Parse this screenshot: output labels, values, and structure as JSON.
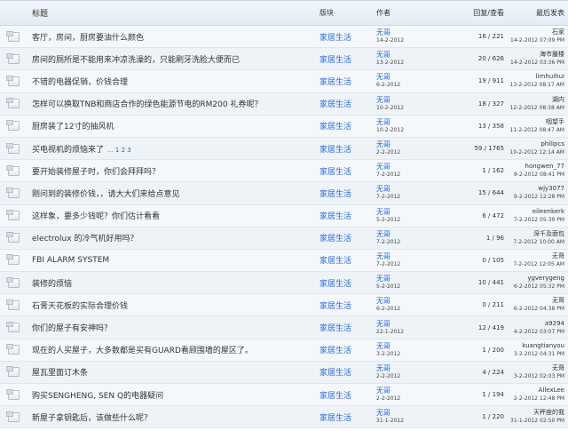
{
  "header": {
    "title": "标题",
    "board": "版块",
    "author": "作者",
    "stats": "回复/查看",
    "last_post": "最后发表"
  },
  "topics": [
    {
      "title": "客厅，房间，厨房要油什么颜色",
      "pages": "",
      "board": "家居生活",
      "author": "无哥",
      "date": "14-2-2012",
      "stats": "16 / 221",
      "last_user": "石家",
      "last_time": "14-2-2012 07:09 PM"
    },
    {
      "title": "房间的厕所是不能用来冲凉洗澡的，只能刷牙洗脸大便而已",
      "pages": "",
      "board": "家居生活",
      "author": "无哥",
      "date": "13-2-2012",
      "stats": "20 / 626",
      "last_user": "海市蜃楼",
      "last_time": "14-2-2012 03:36 PM"
    },
    {
      "title": "不错的电器促销，价钱合理",
      "pages": "",
      "board": "家居生活",
      "author": "无哥",
      "date": "6-2-2012",
      "stats": "19 / 911",
      "last_user": "limhuihui",
      "last_time": "13-2-2012 08:17 AM"
    },
    {
      "title": "怎样可以换取TNB和商店合作的绿色能源节电的RM200 礼券呢？",
      "pages": "",
      "board": "家居生活",
      "author": "无哥",
      "date": "10-2-2012",
      "stats": "18 / 327",
      "last_user": "湖内",
      "last_time": "12-2-2012 08:38 AM"
    },
    {
      "title": "厨房装了12寸的抽风机",
      "pages": "",
      "board": "家居生活",
      "author": "无哥",
      "date": "10-2-2012",
      "stats": "13 / 358",
      "last_user": "咽望手",
      "last_time": "11-2-2012 08:47 AM"
    },
    {
      "title": "买电视机的烦恼来了",
      "pages": "... 1 2 3",
      "board": "家居生活",
      "author": "无哥",
      "date": "2-2-2012",
      "stats": "59 / 1765",
      "last_user": "philipcs",
      "last_time": "10-2-2012 12:14 AM"
    },
    {
      "title": "要开始装修屋子时，你们会拜拜吗？",
      "pages": "",
      "board": "家居生活",
      "author": "无哥",
      "date": "7-2-2012",
      "stats": "1 / 162",
      "last_user": "hongwen_77",
      "last_time": "9-2-2012 08:41 PM"
    },
    {
      "title": "刚问到的装修价钱，，请大大们来给点意见",
      "pages": "",
      "board": "家居生活",
      "author": "无哥",
      "date": "7-2-2012",
      "stats": "15 / 644",
      "last_user": "wjy3077",
      "last_time": "9-2-2012 12:28 PM"
    },
    {
      "title": "这样象，要多少钱呢？你们估计看看",
      "pages": "",
      "board": "家居生活",
      "author": "无哥",
      "date": "5-2-2012",
      "stats": "6 / 472",
      "last_user": "eileenkerk",
      "last_time": "7-2-2012 05:39 PM"
    },
    {
      "title": "electrolux 的冷气机好用吗？",
      "pages": "",
      "board": "家居生活",
      "author": "无哥",
      "date": "7-2-2012",
      "stats": "1 / 96",
      "last_user": "深千及面包",
      "last_time": "7-2-2012 10:00 AM"
    },
    {
      "title": "FBI ALARM SYSTEM",
      "pages": "",
      "board": "家居生活",
      "author": "无哥",
      "date": "7-2-2012",
      "stats": "0 / 105",
      "last_user": "无哥",
      "last_time": "7-2-2012 12:05 AM"
    },
    {
      "title": "装修的烦恼",
      "pages": "",
      "board": "家居生活",
      "author": "无哥",
      "date": "5-2-2012",
      "stats": "10 / 441",
      "last_user": "ygverygeng",
      "last_time": "6-2-2012 05:32 PM"
    },
    {
      "title": "石膏天花板的实际合理价钱",
      "pages": "",
      "board": "家居生活",
      "author": "无哥",
      "date": "6-2-2012",
      "stats": "0 / 211",
      "last_user": "无哥",
      "last_time": "6-2-2012 04:38 PM"
    },
    {
      "title": "你们的屋子有安神吗？",
      "pages": "",
      "board": "家居生活",
      "author": "无哥",
      "date": "22-1-2012",
      "stats": "12 / 419",
      "last_user": "a9294",
      "last_time": "4-2-2012 03:07 PM"
    },
    {
      "title": "现在的人买屋子，大多数都是买有GUARD看顾围墙的屋区了。",
      "pages": "",
      "board": "家居生活",
      "author": "无哥",
      "date": "3-2-2012",
      "stats": "1 / 200",
      "last_user": "kuangtianyou",
      "last_time": "3-2-2012 04:31 PM"
    },
    {
      "title": "屋瓦里面订木条",
      "pages": "",
      "board": "家居生活",
      "author": "无哥",
      "date": "2-2-2012",
      "stats": "4 / 224",
      "last_user": "无哥",
      "last_time": "3-2-2012 02:03 PM"
    },
    {
      "title": "购买SENGHENG, SEN Q的电器疑问",
      "pages": "",
      "board": "家居生活",
      "author": "无哥",
      "date": "2-2-2012",
      "stats": "1 / 194",
      "last_user": "AllexLee",
      "last_time": "2-2-2012 12:48 PM"
    },
    {
      "title": "新屋子拿钥匙后，该做些什么呢？",
      "pages": "",
      "board": "家居生活",
      "author": "无哥",
      "date": "31-1-2012",
      "stats": "1 / 220",
      "last_user": "天秤座的我",
      "last_time": "31-1-2012 02:50 PM"
    }
  ]
}
